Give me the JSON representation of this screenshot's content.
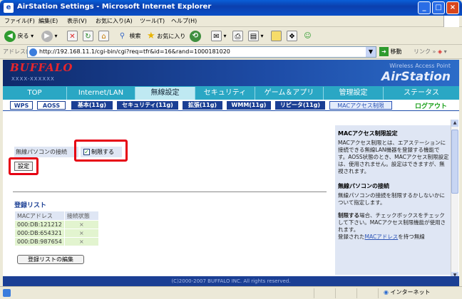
{
  "window": {
    "title": "AirStation Settings - Microsoft Internet Explorer",
    "minimize": "_",
    "maximize": "□",
    "close": "×"
  },
  "menubar": [
    "ファイル(F)",
    "編集(E)",
    "表示(V)",
    "お気に入り(A)",
    "ツール(T)",
    "ヘルプ(H)"
  ],
  "toolbar": {
    "back": "戻る",
    "search": "検索",
    "favorites": "お気に入り"
  },
  "address": {
    "label": "アドレス(D)",
    "url": "http://192.168.11.1/cgi-bin/cgi?req=tfr&id=16&rand=1000181020",
    "go": "移動",
    "links": "リンク"
  },
  "header": {
    "brand": "BUFFALO",
    "brand_sub": "XXXX-XXXXXX",
    "product_sub": "Wireless Access Point",
    "product": "AirStation"
  },
  "nav": [
    "TOP",
    "Internet/LAN",
    "無線設定",
    "セキュリティ",
    "ゲーム＆アプリ",
    "管理設定",
    "ステータス"
  ],
  "subnav": {
    "items": [
      "WPS",
      "AOSS",
      "基本(11g)",
      "セキュリティ(11g)",
      "拡張(11g)",
      "WMM(11g)",
      "リピータ(11g)",
      "MACアクセス制限"
    ],
    "logout": "ログアウト"
  },
  "form": {
    "row_label": "無線パソコンの接続",
    "checkbox_label": "制限する",
    "checkbox_mark": "✓",
    "submit": "設定"
  },
  "registered": {
    "title": "登録リスト",
    "columns": [
      "MACアドレス",
      "接続状態"
    ],
    "rows": [
      {
        "mac": "000:DB:121212",
        "status": "×"
      },
      {
        "mac": "000:DB:654321",
        "status": "×"
      },
      {
        "mac": "000:DB:987654",
        "status": "×"
      }
    ],
    "edit_button": "登録リストの編集"
  },
  "help": {
    "title": "MACアクセス制限設定",
    "p1": "MACアクセス制限とは、エアステーションに接続できる無線LAN機器を登録する機能です。AOSS状態のとき、MACアクセス制限設定は、使用されません。設定はできますが、無視されます。",
    "title2": "無線パソコンの接続",
    "p2": "無線パソコンの接続を制限するかしないかについて指定します。",
    "p3a": "制限する",
    "p3b": "場合、チェックボックスをチェックして下さい。MACアクセス制限機能が使用されます。",
    "p4a": "登録された",
    "p4link": "MACアドレス",
    "p4b": "を持つ無線"
  },
  "footer": "(C)2000-2007 BUFFALO INC. All rights reserved.",
  "status": {
    "zone": "インターネット"
  }
}
